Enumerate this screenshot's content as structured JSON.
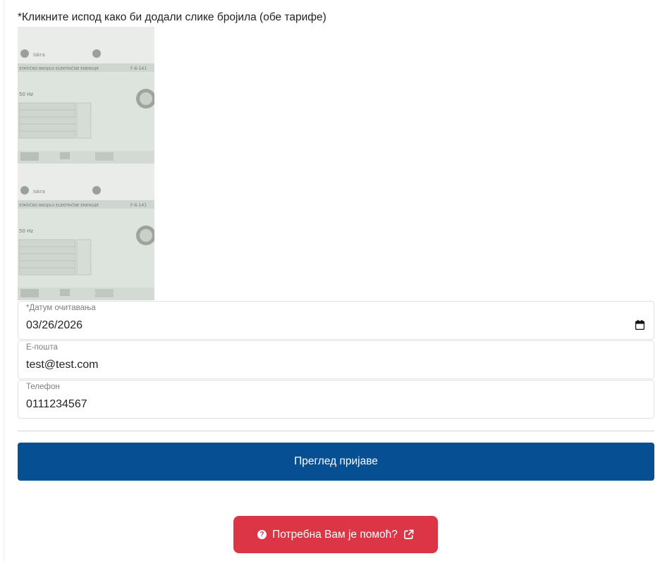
{
  "instruction": "*Кликните испод како би додали слике бројила (обе тарифе)",
  "meter_photos": [
    {
      "icon": "electric-meter-photo",
      "text": {
        "brand": "Iskra",
        "title": "STATIČKO BROJILO ELEKTRIČNE ENERGIJE",
        "model": "F-6-141",
        "freq": "50 Hz"
      }
    },
    {
      "icon": "electric-meter-photo",
      "text": {
        "brand": "Iskra",
        "title": "STATIČKO BROJILO ELEKTRIČNE ENERGIJE",
        "model": "F-6-141",
        "freq": "50 Hz"
      }
    }
  ],
  "form": {
    "date": {
      "label": "*Датум очитавања",
      "value": "03/26/2026"
    },
    "email": {
      "label": "Е-пошта",
      "value": "test@test.com"
    },
    "phone": {
      "label": "Телефон",
      "value": "0111234567"
    }
  },
  "review_button": {
    "label": "Преглед пријаве",
    "color": "#054f92"
  },
  "help_button": {
    "label": "Потребна Вам је помоћ?",
    "color": "#dc3545",
    "icon": "question-circle-icon",
    "trailing_icon": "external-link-icon"
  }
}
